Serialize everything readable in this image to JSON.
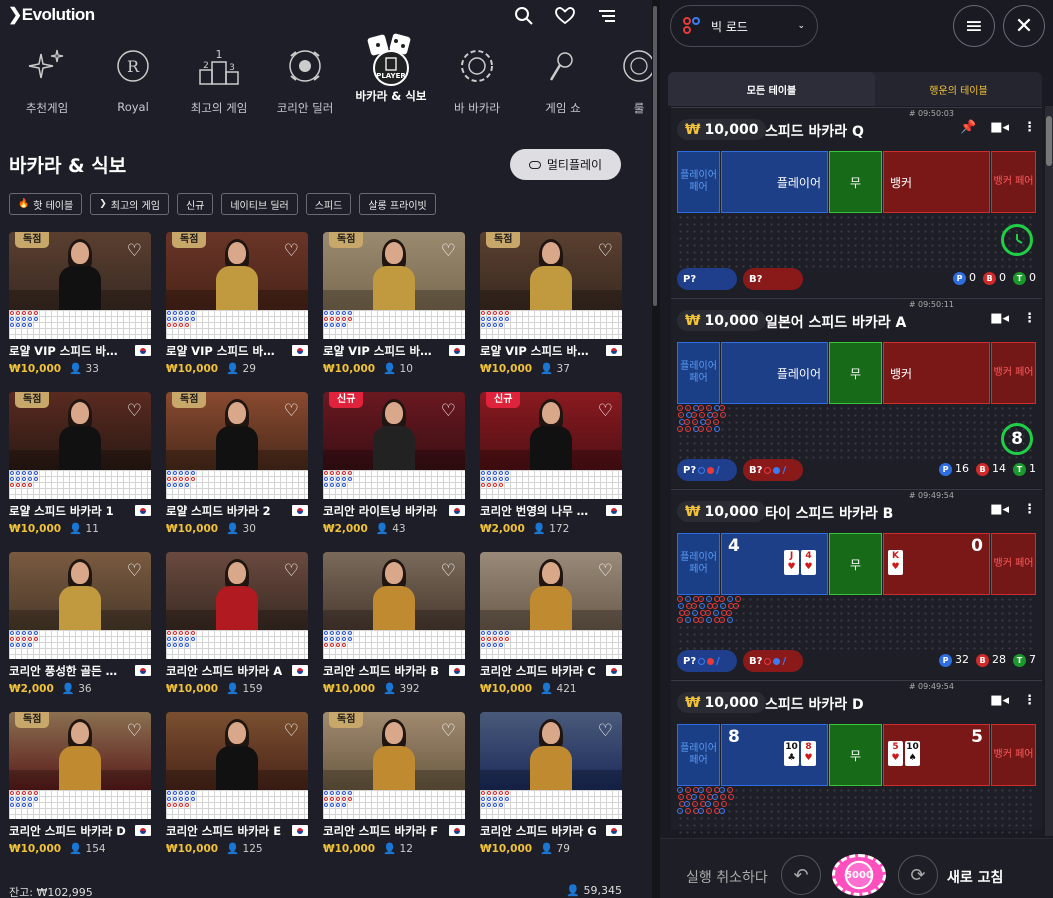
{
  "header": {
    "logo": "Evolution"
  },
  "categories": [
    {
      "label": "추천게임",
      "icon": "sparkle-icon"
    },
    {
      "label": "Royal",
      "icon": "royal-crest-icon"
    },
    {
      "label": "최고의 게임",
      "icon": "podium-icon"
    },
    {
      "label": "코리안 딜러",
      "icon": "korea-flag-icon"
    },
    {
      "label": "바카라 & 식보",
      "icon": "dice-player-icon"
    },
    {
      "label": "바 바카라",
      "icon": "chip-icon"
    },
    {
      "label": "게임 쇼",
      "icon": "microphone-icon"
    },
    {
      "label": "룰",
      "icon": "roulette-icon"
    }
  ],
  "section": {
    "title": "바카라 & 식보",
    "multiplay_label": "멀티플레이"
  },
  "filters": [
    "핫 테이블",
    "최고의 게임",
    "신규",
    "네이티브 딜러",
    "스피드",
    "살롱 프라이빗"
  ],
  "tables": [
    {
      "name": "로얄 VIP 스피드 바카라",
      "bet": "₩10,000",
      "players": "33",
      "badge": "독점"
    },
    {
      "name": "로얄 VIP 스피드 바카라",
      "bet": "₩10,000",
      "players": "29",
      "badge": "독점"
    },
    {
      "name": "로얄 VIP 스피드 바카라",
      "bet": "₩10,000",
      "players": "10",
      "badge": "독점"
    },
    {
      "name": "로얄 VIP 스피드 바카라",
      "bet": "₩10,000",
      "players": "37",
      "badge": "독점"
    },
    {
      "name": "로얄 스피드 바카라 1",
      "bet": "₩10,000",
      "players": "11",
      "badge": "독점"
    },
    {
      "name": "로얄 스피드 바카라 2",
      "bet": "₩10,000",
      "players": "30",
      "badge": "독점"
    },
    {
      "name": "코리안 라이트닝 바카라",
      "bet": "₩2,000",
      "players": "43",
      "badge": "신규"
    },
    {
      "name": "코리안 번영의 나무 바카라",
      "bet": "₩2,000",
      "players": "172",
      "badge": "신규"
    },
    {
      "name": "코리안 풍성한 골든 바카라",
      "bet": "₩2,000",
      "players": "36",
      "badge": ""
    },
    {
      "name": "코리안 스피드 바카라 A",
      "bet": "₩10,000",
      "players": "159",
      "badge": ""
    },
    {
      "name": "코리안 스피드 바카라 B",
      "bet": "₩10,000",
      "players": "392",
      "badge": ""
    },
    {
      "name": "코리안 스피드 바카라 C",
      "bet": "₩10,000",
      "players": "421",
      "badge": ""
    },
    {
      "name": "코리안 스피드 바카라 D",
      "bet": "₩10,000",
      "players": "154",
      "badge": "독점"
    },
    {
      "name": "코리안 스피드 바카라 E",
      "bet": "₩10,000",
      "players": "125",
      "badge": ""
    },
    {
      "name": "코리안 스피드 바카라 F",
      "bet": "₩10,000",
      "players": "12",
      "badge": "독점"
    },
    {
      "name": "코리안 스피드 바카라 G",
      "bet": "₩10,000",
      "players": "79",
      "badge": ""
    }
  ],
  "footer": {
    "balance": "잔고: ₩102,995",
    "online": "59,345"
  },
  "right": {
    "road_selector": "빅 로드",
    "tabs": {
      "all": "모든 테이블",
      "lucky": "행운의 테이블"
    },
    "labels": {
      "pp": "플레이어 페어",
      "player": "플레이어",
      "tie": "무",
      "banker": "뱅커",
      "bp": "뱅커 페어",
      "pb": "P?",
      "bb": "B?"
    },
    "games": [
      {
        "id": "# 09:50:03",
        "bet": "₩10,000",
        "name": "스피드 바카라 Q",
        "pinned": true,
        "p_score": "",
        "b_score": "",
        "p_cards": [],
        "b_cards": [],
        "timer": "",
        "p": "0",
        "b": "0",
        "t": "0"
      },
      {
        "id": "# 09:50:11",
        "bet": "₩10,000",
        "name": "일본어 스피드 바카라 A",
        "pinned": false,
        "p_score": "",
        "b_score": "",
        "p_cards": [],
        "b_cards": [],
        "timer": "8",
        "p": "16",
        "b": "14",
        "t": "1"
      },
      {
        "id": "# 09:49:54",
        "bet": "₩10,000",
        "name": "타이 스피드 바카라 B",
        "pinned": false,
        "p_score": "4",
        "b_score": "0",
        "p_cards": [
          "J",
          "4"
        ],
        "b_cards": [
          "K"
        ],
        "timer": "",
        "p": "32",
        "b": "28",
        "t": "7"
      },
      {
        "id": "# 09:49:54",
        "bet": "₩10,000",
        "name": "스피드 바카라 D",
        "pinned": false,
        "p_score": "8",
        "b_score": "5",
        "p_cards": [
          "10",
          "8"
        ],
        "b_cards": [
          "5",
          "10"
        ],
        "timer": "",
        "p": "",
        "b": "",
        "t": ""
      }
    ],
    "footer": {
      "undo": "실행 취소하다",
      "chip": "5000",
      "refresh": "새로 고침"
    }
  },
  "colors": {
    "accent_gold": "#f0c23a",
    "player_blue": "#1c3f88",
    "banker_red": "#7a1717",
    "tie_green": "#166a18"
  }
}
